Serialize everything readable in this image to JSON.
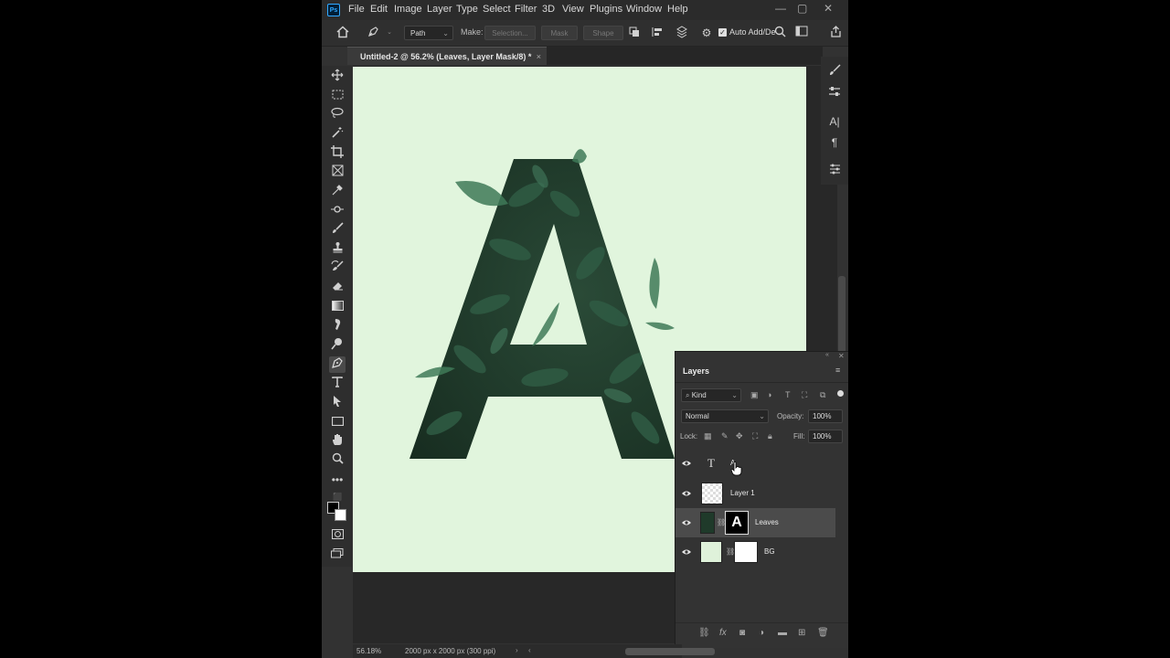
{
  "menu": [
    "File",
    "Edit",
    "Image",
    "Layer",
    "Type",
    "Select",
    "Filter",
    "3D",
    "View",
    "Plugins",
    "Window",
    "Help"
  ],
  "app_logo": "Ps",
  "window_controls": {
    "minimize": "—",
    "restore": "▢",
    "close": "✕"
  },
  "options": {
    "tool_mode": "Path",
    "make_label": "Make:",
    "selection_btn": "Selection...",
    "mask_btn": "Mask",
    "shape_btn": "Shape",
    "auto_add_label": "Auto Add/De",
    "auto_add_checked": true
  },
  "document_tab": {
    "title": "Untitled-2 @ 56.2% (Leaves, Layer Mask/8) *",
    "close": "×"
  },
  "canvas": {
    "background": "#e1f5dd",
    "letter": "A",
    "letter_color": "#1e3b2c"
  },
  "tools": [
    "move",
    "marquee",
    "lasso",
    "magic-wand",
    "crop",
    "frame",
    "eyedropper",
    "healing",
    "brush",
    "stamp",
    "history-brush",
    "eraser",
    "gradient",
    "smudge",
    "dodge",
    "pen",
    "type",
    "path-select",
    "rectangle",
    "hand",
    "zoom",
    "more"
  ],
  "layers_panel": {
    "title": "Layers",
    "filter_kind": "Kind",
    "blend_mode": "Normal",
    "opacity_label": "Opacity:",
    "opacity_value": "100%",
    "lock_label": "Lock:",
    "fill_label": "Fill:",
    "fill_value": "100%",
    "layers": [
      {
        "name": "A",
        "kind": "text",
        "visible": true,
        "selected": false
      },
      {
        "name": "Layer 1",
        "kind": "pixel",
        "visible": true,
        "selected": false
      },
      {
        "name": "Leaves",
        "kind": "masked",
        "visible": true,
        "selected": true,
        "mask_letter": "A"
      },
      {
        "name": "BG",
        "kind": "masked",
        "visible": true,
        "selected": false
      }
    ]
  },
  "status": {
    "zoom": "56.18%",
    "doc_info": "2000 px x 2000 px (300 ppi)"
  }
}
